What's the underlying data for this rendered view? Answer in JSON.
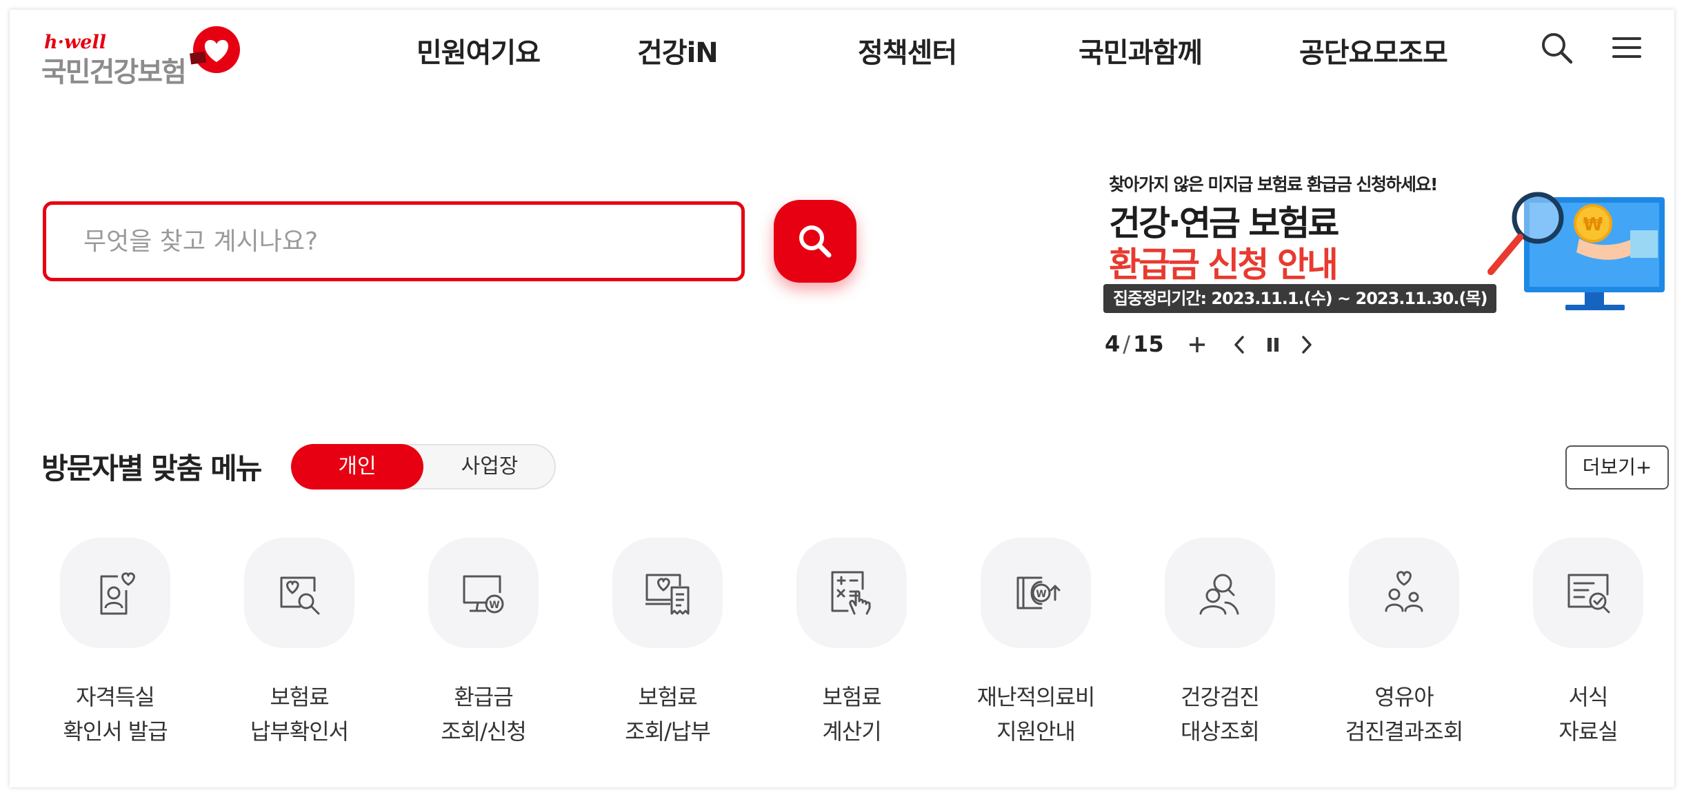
{
  "header": {
    "logo_sub": "h·well",
    "logo_main": "국민건강보험",
    "nav": [
      "민원여기요",
      "건강iN",
      "정책센터",
      "국민과함께",
      "공단요모조모"
    ],
    "icons": [
      "search-icon",
      "menu-icon"
    ]
  },
  "search": {
    "placeholder": "무엇을 찾고 계시나요?",
    "value": ""
  },
  "banner": {
    "top_text": "찾아가지 않은 미지급 보험료 환급금 신청하세요!",
    "line1": "건강·연금 보험료",
    "line2": "환급금 신청 안내",
    "period": "집중정리기간: 2023.11.1.(수) ~ 2023.11.30.(목)",
    "current": "4",
    "separator": "/",
    "total": "15"
  },
  "visitor_menu": {
    "title": "방문자별 맞춤 메뉴",
    "tabs": [
      "개인",
      "사업장"
    ],
    "active_tab": "개인",
    "more_label": "더보기+",
    "items": [
      {
        "line1": "자격득실",
        "line2": "확인서 발급",
        "icon": "qualification-certificate-icon"
      },
      {
        "line1": "보험료",
        "line2": "납부확인서",
        "icon": "payment-confirmation-icon"
      },
      {
        "line1": "환급금",
        "line2": "조회/신청",
        "icon": "refund-monitor-icon"
      },
      {
        "line1": "보험료",
        "line2": "조회/납부",
        "icon": "premium-inquiry-icon"
      },
      {
        "line1": "보험료",
        "line2": "계산기",
        "icon": "calculator-icon"
      },
      {
        "line1": "재난적의료비",
        "line2": "지원안내",
        "icon": "medical-support-icon"
      },
      {
        "line1": "건강검진",
        "line2": "대상조회",
        "icon": "checkup-target-icon"
      },
      {
        "line1": "영유아",
        "line2": "검진결과조회",
        "icon": "infant-checkup-icon"
      },
      {
        "line1": "서식",
        "line2": "자료실",
        "icon": "forms-library-icon"
      }
    ]
  },
  "colors": {
    "brand_red": "#e60012",
    "banner_red": "#e83a2f",
    "logo_gray": "#8c8c8c",
    "icon_bg": "#f4f4f6"
  }
}
